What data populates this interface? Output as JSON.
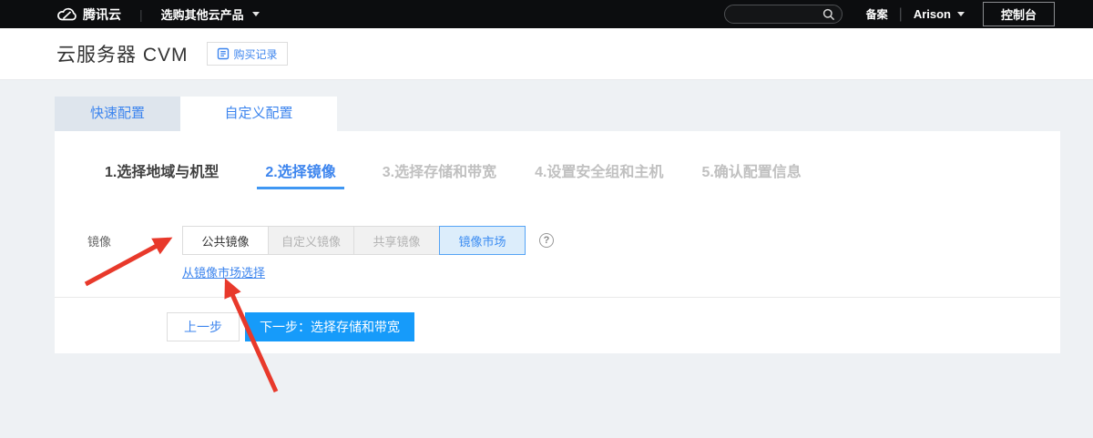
{
  "topbar": {
    "brand": "腾讯云",
    "product_nav": "选购其他云产品",
    "beian_link": "备案",
    "user_name": "Arison",
    "console_button": "控制台"
  },
  "header": {
    "title": "云服务器 CVM",
    "purchase_records_button": "购买记录"
  },
  "tabs": [
    {
      "label": "快速配置",
      "active": false
    },
    {
      "label": "自定义配置",
      "active": true
    }
  ],
  "steps": [
    {
      "label": "1.选择地域与机型",
      "state": "done"
    },
    {
      "label": "2.选择镜像",
      "state": "active"
    },
    {
      "label": "3.选择存储和带宽",
      "state": "pending"
    },
    {
      "label": "4.设置安全组和主机",
      "state": "pending"
    },
    {
      "label": "5.确认配置信息",
      "state": "pending"
    }
  ],
  "image_section": {
    "label": "镜像",
    "options": [
      {
        "label": "公共镜像",
        "state": "normal"
      },
      {
        "label": "自定义镜像",
        "state": "dimmed"
      },
      {
        "label": "共享镜像",
        "state": "dimmed"
      },
      {
        "label": "镜像市场",
        "state": "selected"
      }
    ],
    "help_icon": "question-circle-icon",
    "market_link": "从镜像市场选择"
  },
  "footer": {
    "prev_button": "上一步",
    "next_button": "下一步：选择存储和带宽"
  },
  "icons": {
    "logo": "tencent-cloud-logo",
    "search": "search-icon",
    "purchase": "purchase-record-icon",
    "help": "?"
  },
  "annotations": {
    "arrow_1_target": "公共镜像",
    "arrow_2_target": "从镜像市场选择",
    "arrow_color": "#e8392b"
  },
  "colors": {
    "topbar_bg": "#0c0d0f",
    "page_bg": "#eef1f4",
    "accent_blue": "#3d85ee",
    "primary_button_blue": "#169bfa",
    "selected_bg": "#dcedfb",
    "tab_inactive_bg": "#dee5ed",
    "annotation_red": "#e8392b"
  }
}
